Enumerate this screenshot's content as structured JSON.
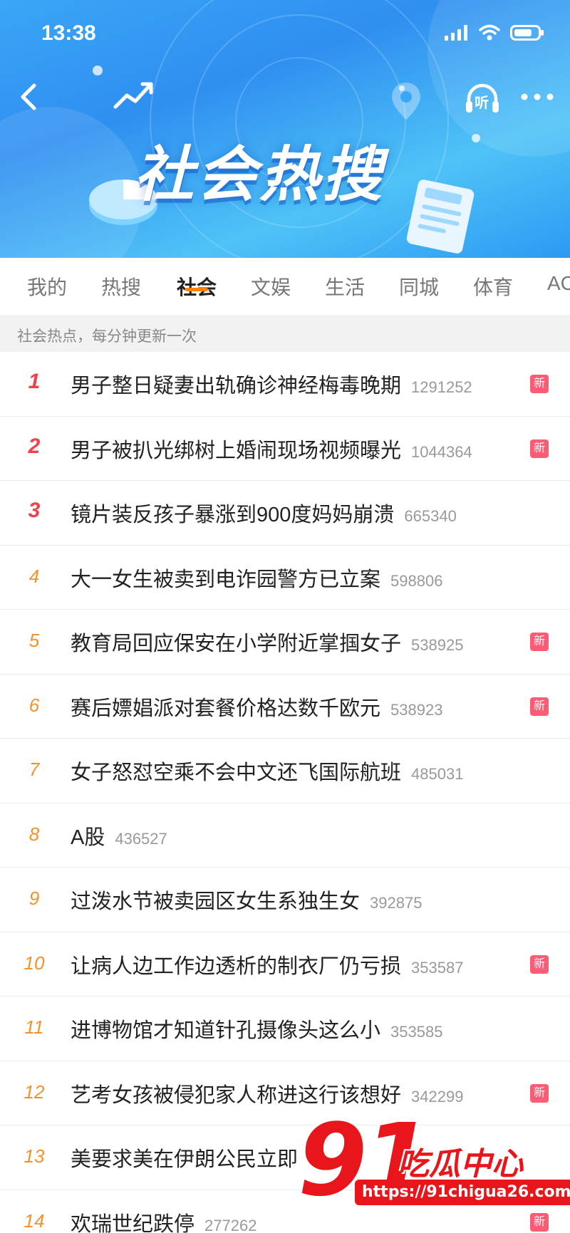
{
  "status_bar": {
    "time": "13:38"
  },
  "header": {
    "title": "社会热搜",
    "listen_label": "听",
    "colors": {
      "banner": "#2f8ff0",
      "accent": "#ff8200"
    }
  },
  "tabs": [
    {
      "label": "我的"
    },
    {
      "label": "热搜"
    },
    {
      "label": "社会",
      "active": true
    },
    {
      "label": "文娱"
    },
    {
      "label": "生活"
    },
    {
      "label": "同城"
    },
    {
      "label": "体育"
    },
    {
      "label": "AC"
    }
  ],
  "subheader": "社会热点，每分钟更新一次",
  "list": [
    {
      "rank": "1",
      "title": "男子整日疑妻出轨确诊神经梅毒晚期",
      "count": "1291252",
      "badge": "新"
    },
    {
      "rank": "2",
      "title": "男子被扒光绑树上婚闹现场视频曝光",
      "count": "1044364",
      "badge": "新"
    },
    {
      "rank": "3",
      "title": "镜片装反孩子暴涨到900度妈妈崩溃",
      "count": "665340",
      "badge": ""
    },
    {
      "rank": "4",
      "title": "大一女生被卖到电诈园警方已立案",
      "count": "598806",
      "badge": ""
    },
    {
      "rank": "5",
      "title": "教育局回应保安在小学附近掌掴女子",
      "count": "538925",
      "badge": "新"
    },
    {
      "rank": "6",
      "title": "赛后嫖娼派对套餐价格达数千欧元",
      "count": "538923",
      "badge": "新"
    },
    {
      "rank": "7",
      "title": "女子怒怼空乘不会中文还飞国际航班",
      "count": "485031",
      "badge": ""
    },
    {
      "rank": "8",
      "title": "A股",
      "count": "436527",
      "badge": ""
    },
    {
      "rank": "9",
      "title": "过泼水节被卖园区女生系独生女",
      "count": "392875",
      "badge": ""
    },
    {
      "rank": "10",
      "title": "让病人边工作边透析的制衣厂仍亏损",
      "count": "353587",
      "badge": "新"
    },
    {
      "rank": "11",
      "title": "进博物馆才知道针孔摄像头这么小",
      "count": "353585",
      "badge": ""
    },
    {
      "rank": "12",
      "title": "艺考女孩被侵犯家人称进这行该想好",
      "count": "342299",
      "badge": "新"
    },
    {
      "rank": "13",
      "title": "美要求美在伊朗公民立即",
      "count": "",
      "badge": ""
    },
    {
      "rank": "14",
      "title": "欢瑞世纪跌停",
      "count": "277262",
      "badge": "新"
    }
  ],
  "watermark": {
    "number": "91",
    "text": "吃瓜中心",
    "url": "https://91chigua26.com"
  }
}
